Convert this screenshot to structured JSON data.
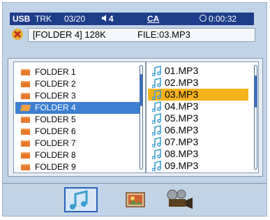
{
  "status_bar": {
    "source": "USB",
    "track_label": "TRK",
    "track_number": "03/20",
    "audio_indicator": "4",
    "channel": "CA",
    "time": "0:00:32"
  },
  "now_playing": {
    "folder": "[FOLDER 4] 128K",
    "file": "FILE:03.MP3"
  },
  "folders": [
    {
      "name": "FOLDER 1",
      "selected": false
    },
    {
      "name": "FOLDER 2",
      "selected": false
    },
    {
      "name": "FOLDER 3",
      "selected": false
    },
    {
      "name": "FOLDER 4",
      "selected": true
    },
    {
      "name": "FOLDER 5",
      "selected": false
    },
    {
      "name": "FOLDER 6",
      "selected": false
    },
    {
      "name": "FOLDER 7",
      "selected": false
    },
    {
      "name": "FOLDER 8",
      "selected": false
    },
    {
      "name": "FOLDER 9",
      "selected": false
    }
  ],
  "files": [
    {
      "name": "01.MP3",
      "selected": false
    },
    {
      "name": "02.MP3",
      "selected": false
    },
    {
      "name": "03.MP3",
      "selected": true
    },
    {
      "name": "04.MP3",
      "selected": false
    },
    {
      "name": "05.MP3",
      "selected": false
    },
    {
      "name": "06.MP3",
      "selected": false
    },
    {
      "name": "07.MP3",
      "selected": false
    },
    {
      "name": "08.MP3",
      "selected": false
    },
    {
      "name": "09.MP3",
      "selected": false
    }
  ],
  "media_tabs": [
    {
      "icon": "music-note-icon",
      "active": true
    },
    {
      "icon": "photo-icon",
      "active": false
    },
    {
      "icon": "movie-camera-icon",
      "active": false
    }
  ],
  "colors": {
    "background": "#c1d3e6",
    "status_bar": "#1e3c8a",
    "folder_selection": "#3d7fd1",
    "file_selection": "#f7b31b",
    "folder_icon": "#e8792a",
    "note_icon": "#3aa0d0"
  }
}
